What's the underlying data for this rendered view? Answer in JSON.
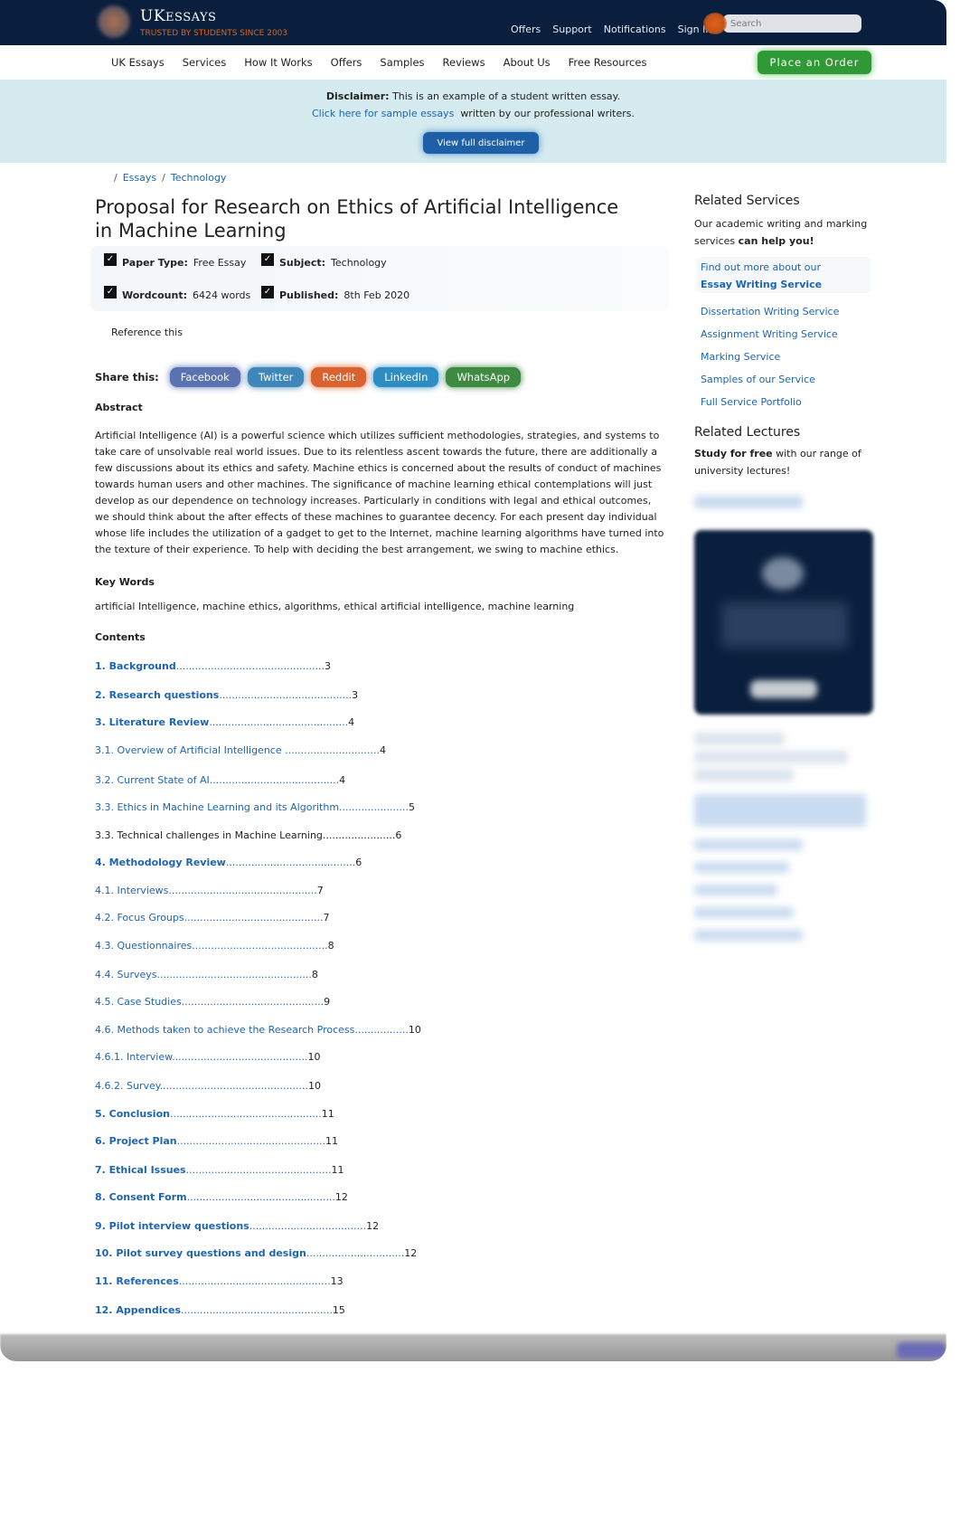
{
  "header": {
    "logo_main": "UK",
    "logo_rest": "ESSAYS",
    "tagline": "TRUSTED BY STUDENTS SINCE 2003",
    "top_links": [
      "Offers",
      "Support",
      "Notifications",
      "Sign In"
    ],
    "search_placeholder": "Search"
  },
  "nav": {
    "items": [
      "UK Essays",
      "Services",
      "How It Works",
      "Offers",
      "Samples",
      "Reviews",
      "About Us",
      "Free Resources"
    ],
    "order_button": "Place an Order"
  },
  "disclaimer": {
    "label": "Disclaimer:",
    "text": "This is an example of a student written essay.",
    "link": "Click here for sample essays",
    "link_suffix": "written by our professional writers.",
    "button": "View full disclaimer"
  },
  "breadcrumb": [
    "Essays",
    "Technology"
  ],
  "article": {
    "title": "Proposal for Research on Ethics of Artificial Intelligence in Machine Learning",
    "meta": {
      "paper_type_label": "Paper Type:",
      "paper_type": "Free Essay",
      "subject_label": "Subject:",
      "subject": "Technology",
      "wordcount_label": "Wordcount:",
      "wordcount": "6424 words",
      "published_label": "Published:",
      "published": "8th Feb 2020"
    },
    "reference": "Reference this",
    "share_label": "Share this:",
    "share_buttons": [
      "Facebook",
      "Twitter",
      "Reddit",
      "LinkedIn",
      "WhatsApp"
    ],
    "share_colors": [
      "#5b72b0",
      "#3f87b8",
      "#d9622e",
      "#2e8ec4",
      "#3d8a40"
    ],
    "abstract_heading": "Abstract",
    "abstract": "Artificial Intelligence (AI) is a powerful science which utilizes sufficient methodologies, strategies, and systems to take care of unsolvable real world issues. Due to its relentless ascent towards the future, there are additionally a few discussions about its ethics and safety. Machine ethics is concerned about the results of conduct of machines towards human users and other machines. The significance of machine learning ethical contemplations will just develop as our dependence on technology increases. Particularly in conditions with legal and ethical outcomes, we should think about the after effects of these machines to guarantee decency. For each present day individual whose life includes the utilization of a gadget to get to the Internet, machine learning algorithms have turned into the texture of their experience. To help with deciding the best arrangement, we swing to machine ethics.",
    "keywords_heading": "Key Words",
    "keywords": "artificial Intelligence, machine ethics, algorithms, ethical artificial intelligence, machine learning",
    "contents_heading": "Contents",
    "toc": [
      {
        "label": "1. Background",
        "dots": "...............................................",
        "page": "3",
        "style": "bold"
      },
      {
        "label": "2. Research questions",
        "dots": "..........................................",
        "page": "3",
        "style": "bold"
      },
      {
        "label": "3. Literature Review",
        "dots": "............................................",
        "page": "4",
        "style": "bold"
      },
      {
        "label": "3.1. Overview of Artificial Intelligence ",
        "dots": "..............................",
        "page": "4",
        "style": "link"
      },
      {
        "label": "3.2. Current State of AI",
        "dots": ".........................................",
        "page": "4",
        "style": "link"
      },
      {
        "label": "3.3. Ethics in Machine Learning and its Algorithm",
        "dots": "......................",
        "page": "5",
        "style": "link"
      },
      {
        "label": "3.3. Technical challenges in Machine Learning",
        "dots": ".......................",
        "page": "6",
        "style": "plain"
      },
      {
        "label": "4. Methodology Review",
        "dots": ".........................................",
        "page": "6",
        "style": "bold"
      },
      {
        "label": "4.1. Interviews",
        "dots": "...............................................",
        "page": "7",
        "style": "link"
      },
      {
        "label": "4.2. Focus Groups",
        "dots": "............................................",
        "page": "7",
        "style": "link"
      },
      {
        "label": "4.3. Questionnaires",
        "dots": "...........................................",
        "page": "8",
        "style": "link"
      },
      {
        "label": "4.4. Surveys",
        "dots": ".................................................",
        "page": "8",
        "style": "link"
      },
      {
        "label": "4.5. Case Studies",
        "dots": ".............................................",
        "page": "9",
        "style": "link"
      },
      {
        "label": "4.6. Methods taken to achieve the Research Process",
        "dots": ".................",
        "page": "10",
        "style": "link"
      },
      {
        "label": "4.6.1. Interview",
        "dots": "...........................................",
        "page": "10",
        "style": "link"
      },
      {
        "label": "4.6.2. Survey",
        "dots": "...............................................",
        "page": "10",
        "style": "link"
      },
      {
        "label": "5. Conclusion",
        "dots": "................................................",
        "page": "11",
        "style": "bold"
      },
      {
        "label": "6. Project Plan",
        "dots": "...............................................",
        "page": "11",
        "style": "bold"
      },
      {
        "label": "7. Ethical Issues",
        "dots": "..............................................",
        "page": "11",
        "style": "bold"
      },
      {
        "label": "8. Consent Form",
        "dots": "...............................................",
        "page": "12",
        "style": "bold"
      },
      {
        "label": "9. Pilot interview questions",
        "dots": ".....................................",
        "page": "12",
        "style": "bold"
      },
      {
        "label": "10. Pilot survey questions and design",
        "dots": "...............................",
        "page": "12",
        "style": "bold"
      },
      {
        "label": "11. References",
        "dots": "................................................",
        "page": "13",
        "style": "bold"
      },
      {
        "label": "12. Appendices",
        "dots": "................................................",
        "page": "15",
        "style": "bold"
      }
    ]
  },
  "sidebar": {
    "services_heading": "Related Services",
    "services_intro": "Our academic writing and marking services ",
    "services_intro_bold": "can help you!",
    "featured_prefix": "Find out more about our",
    "featured_link": "Essay Writing Service",
    "links": [
      "Dissertation Writing Service",
      "Assignment Writing Service",
      "Marking Service",
      "Samples of our Service",
      "Full Service Portfolio"
    ],
    "lectures_heading": "Related Lectures",
    "lectures_bold": "Study for free",
    "lectures_text": " with our range of university lectures!"
  }
}
